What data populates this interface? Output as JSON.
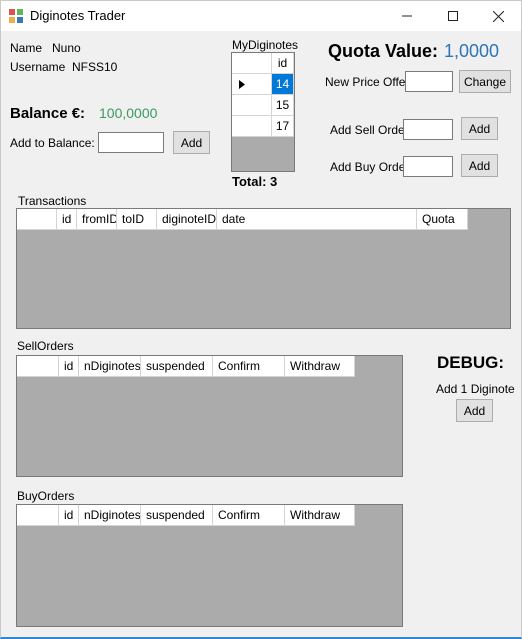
{
  "window": {
    "title": "Diginotes Trader"
  },
  "user": {
    "name_label": "Name",
    "name_value": "Nuno",
    "username_label": "Username",
    "username_value": "NFSS10"
  },
  "balance": {
    "label": "Balance €:",
    "value": "100,0000",
    "add_label": "Add to Balance:",
    "add_value": "",
    "add_button": "Add"
  },
  "my_diginotes": {
    "label": "MyDiginotes",
    "column": "id",
    "rows": [
      "14",
      "15",
      "17"
    ],
    "selected_row": 0,
    "total": "Total: 3"
  },
  "quota": {
    "label": "Quota Value:",
    "value": "1,0000",
    "new_price_label": "New Price Offer",
    "new_price_value": "",
    "change_button": "Change",
    "sell_label": "Add Sell Order",
    "sell_value": "",
    "sell_button": "Add",
    "buy_label": "Add Buy Order",
    "buy_value": "",
    "buy_button": "Add"
  },
  "transactions": {
    "label": "Transactions",
    "columns": [
      "",
      "id",
      "fromID",
      "toID",
      "diginoteID",
      "date",
      "Quota"
    ]
  },
  "sell_orders": {
    "label": "SellOrders",
    "columns": [
      "",
      "id",
      "nDiginotes",
      "suspended",
      "Confirm",
      "Withdraw"
    ]
  },
  "buy_orders": {
    "label": "BuyOrders",
    "columns": [
      "",
      "id",
      "nDiginotes",
      "suspended",
      "Confirm",
      "Withdraw"
    ]
  },
  "debug": {
    "label": "DEBUG:",
    "add_label": "Add 1 Diginote",
    "add_button": "Add"
  },
  "colors": {
    "accent_blue": "#2e75b6",
    "balance_green": "#3c9a5f",
    "selection": "#0078d7"
  }
}
